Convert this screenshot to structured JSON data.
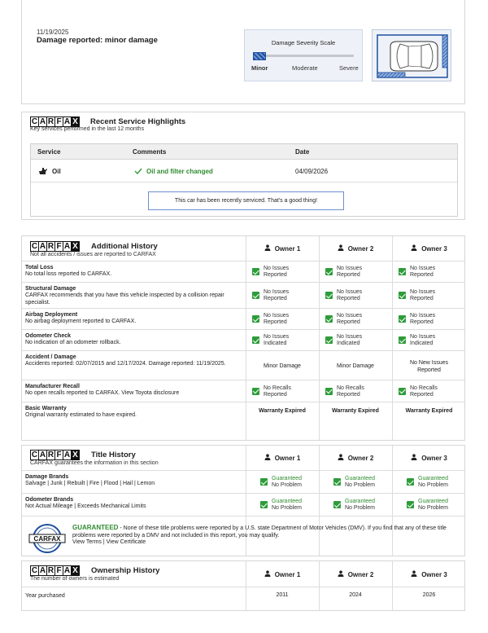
{
  "damage": {
    "date": "11/19/2025",
    "description": "Damage reported: minor damage",
    "scale_title": "Damage Severity Scale",
    "scale_labels": [
      "Minor",
      "Moderate",
      "Severe"
    ],
    "severity_level": "Minor"
  },
  "brand": {
    "logo_letters": [
      "C",
      "A",
      "R",
      "F",
      "A",
      "X"
    ]
  },
  "service": {
    "title": "Recent Service Highlights",
    "subtitle": "Key services performed in the last 12 months",
    "columns": [
      "Service",
      "Comments",
      "Date"
    ],
    "rows": [
      {
        "service": "Oil",
        "comment": "Oil and filter changed",
        "date": "04/09/2026"
      }
    ],
    "message": "This car has been recently serviced. That's a good thing!"
  },
  "owners": [
    "Owner 1",
    "Owner 2",
    "Owner 3"
  ],
  "additional": {
    "title": "Additional History",
    "subtitle": "Not all accidents / issues are reported to CARFAX",
    "rows": [
      {
        "label": "Total Loss",
        "desc": "No total loss reported to CARFAX.",
        "check": true,
        "values": [
          "No Issues Reported",
          "No Issues Reported",
          "No Issues Reported"
        ]
      },
      {
        "label": "Structural Damage",
        "desc": "CARFAX recommends that you have this vehicle inspected by a collision repair specialist.",
        "check": true,
        "values": [
          "No Issues Reported",
          "No Issues Reported",
          "No Issues Reported"
        ]
      },
      {
        "label": "Airbag Deployment",
        "desc": "No airbag deployment reported to CARFAX.",
        "check": true,
        "values": [
          "No Issues Reported",
          "No Issues Reported",
          "No Issues Reported"
        ]
      },
      {
        "label": "Odometer Check",
        "desc": "No indication of an odometer rollback.",
        "check": true,
        "values": [
          "No Issues Indicated",
          "No Issues Indicated",
          "No Issues Indicated"
        ]
      },
      {
        "label": "Accident / Damage",
        "desc": "Accidents reported: 02/07/2015 and 12/17/2024. Damage reported: 11/19/2025.",
        "check": false,
        "values": [
          "Minor Damage",
          "Minor Damage",
          "No New Issues Reported"
        ]
      },
      {
        "label": "Manufacturer Recall",
        "desc": "No open recalls reported to CARFAX. View Toyota disclosure",
        "check": true,
        "values": [
          "No Recalls Reported",
          "No Recalls Reported",
          "No Recalls Reported"
        ]
      },
      {
        "label": "Basic Warranty",
        "desc": "Original warranty estimated to have expired.",
        "check": false,
        "bold": true,
        "values": [
          "Warranty Expired",
          "Warranty Expired",
          "Warranty Expired"
        ]
      }
    ]
  },
  "title_history": {
    "title": "Title History",
    "subtitle": "CARFAX guarantees the information in this section",
    "rows": [
      {
        "label": "Damage Brands",
        "desc": "Salvage | Junk | Rebuilt | Fire | Flood | Hail | Lemon",
        "values": [
          "Guaranteed",
          "Guaranteed",
          "Guaranteed"
        ],
        "sub": "No Problem"
      },
      {
        "label": "Odometer Brands",
        "desc": "Not Actual Mileage | Exceeds Mechanical Limits",
        "values": [
          "Guaranteed",
          "Guaranteed",
          "Guaranteed"
        ],
        "sub": "No Problem"
      }
    ],
    "guarantee_head": "GUARANTEED",
    "guarantee_text": " - None of these title problems were reported by a U.S. state Department of Motor Vehicles (DMV). If you find that any of these title problems were reported by a DMV and not included in this report, you may qualify.",
    "guarantee_links": "View Terms | View Certificate",
    "seal_text": "CARFAX"
  },
  "ownership": {
    "title": "Ownership History",
    "subtitle": "The number of owners is estimated",
    "row_label": "Year purchased",
    "years": [
      "2011",
      "2024",
      "2026"
    ]
  }
}
